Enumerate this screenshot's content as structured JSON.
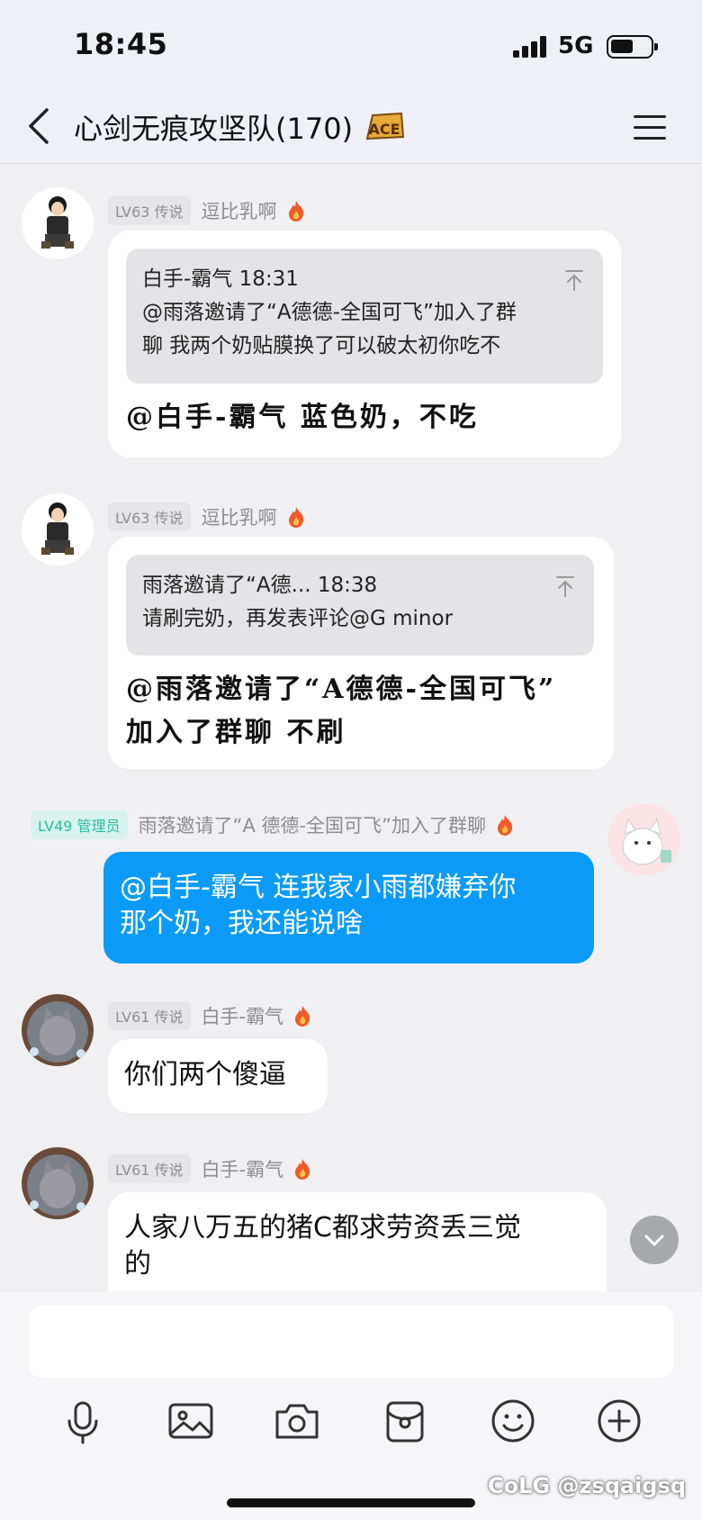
{
  "status_bar": {
    "time": "18:45",
    "network": "5G"
  },
  "header": {
    "title": "心剑无痕攻坚队(170)",
    "badge_text": "ACE"
  },
  "messages": [
    {
      "level": "LV63 传说",
      "sender": "逗比乳啊",
      "quote": {
        "line1": "白手-霸气 18:31",
        "line2": "@雨落邀请了“A德德-全国可飞”加入了群",
        "line3": "聊 我两个奶贴膜换了可以破太初你吃不"
      },
      "text_lines": [
        "@白手-霸气 蓝色奶，不吃"
      ]
    },
    {
      "level": "LV63 传说",
      "sender": "逗比乳啊",
      "quote": {
        "line1": "雨落邀请了“A德... 18:38",
        "line2": "请刷完奶，再发表评论@G minor"
      },
      "text_lines": [
        "@雨落邀请了“A德德-全国可飞”",
        "加入了群聊 不刷"
      ]
    },
    {
      "level": "LV49 管理员",
      "sender": "雨落邀请了“A 德德-全国可飞”加入了群聊",
      "text_lines": [
        "@白手-霸气 连我家小雨都嫌弃你",
        "那个奶，我还能说啥"
      ]
    },
    {
      "level": "LV61 传说",
      "sender": "白手-霸气",
      "text_lines": [
        "你们两个傻逼"
      ]
    },
    {
      "level": "LV61 传说",
      "sender": "白手-霸气",
      "text_lines": [
        "人家八万五的猪C都求劳资丢三觉",
        "的"
      ]
    }
  ],
  "input": {
    "placeholder": ""
  },
  "toolbar": [
    "microphone-icon",
    "image-icon",
    "camera-icon",
    "red-packet-icon",
    "emoji-icon",
    "plus-icon"
  ],
  "watermark": "CoLG @zsqaigsq",
  "colors": {
    "accent_blue": "#0b9bf7",
    "admin_green": "#2bbd9f"
  }
}
